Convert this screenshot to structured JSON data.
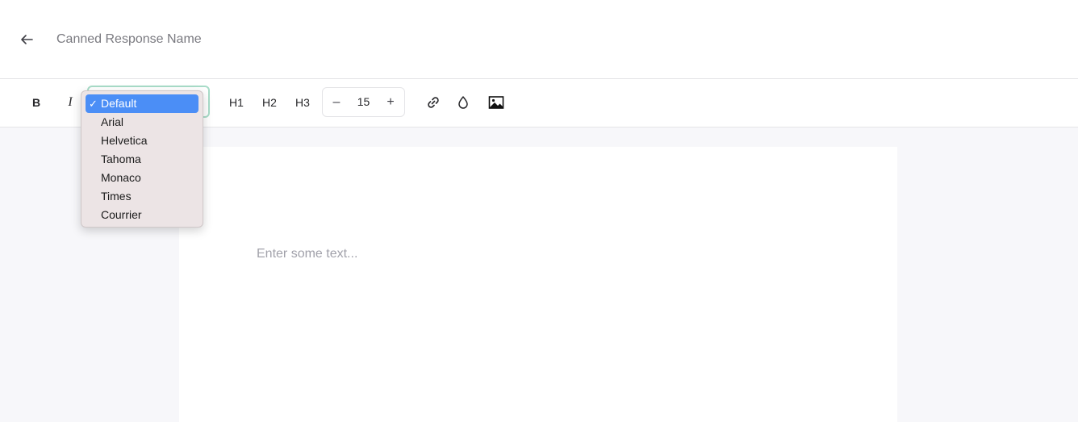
{
  "header": {
    "title_placeholder": "Canned Response Name",
    "back_icon": "arrow-left-icon"
  },
  "toolbar": {
    "bold_label": "B",
    "italic_label": "I",
    "h1_label": "H1",
    "h2_label": "H2",
    "h3_label": "H3",
    "font_size": "15",
    "minus_label": "–",
    "plus_label": "+",
    "icons": [
      "link-icon",
      "drop-icon",
      "image-icon"
    ]
  },
  "font_dropdown": {
    "selected": "Default",
    "check_mark": "✓",
    "options": [
      "Default",
      "Arial",
      "Helvetica",
      "Tahoma",
      "Monaco",
      "Times",
      "Courrier"
    ]
  },
  "editor": {
    "placeholder": "Enter some text..."
  },
  "colors": {
    "accent_selected": "#4b8ef6",
    "focus_ring": "#a8dcc8",
    "canvas_bg": "#f7f7fa"
  }
}
